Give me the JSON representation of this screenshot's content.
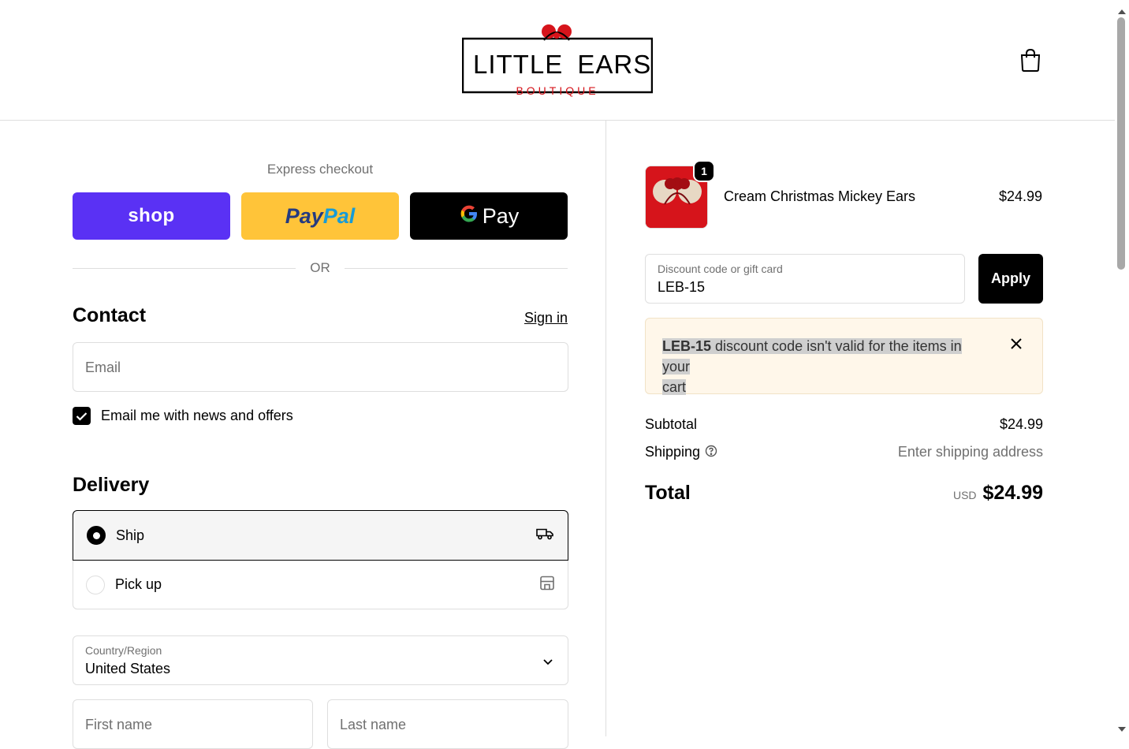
{
  "header": {
    "logo_title": "LITTLE EARS",
    "logo_subtitle": "BOUTIQUE",
    "cart_icon": "shopping-bag-icon"
  },
  "express": {
    "title": "Express checkout",
    "shop_label": "shop",
    "paypal_label_1": "Pay",
    "paypal_label_2": "Pal",
    "gpay_label": "Pay",
    "or_label": "OR"
  },
  "contact": {
    "title": "Contact",
    "sign_in": "Sign in",
    "email_placeholder": "Email",
    "newsletter_label": "Email me with news and offers",
    "newsletter_checked": true
  },
  "delivery": {
    "title": "Delivery",
    "options": [
      {
        "label": "Ship",
        "icon": "truck-icon",
        "selected": true
      },
      {
        "label": "Pick up",
        "icon": "store-icon",
        "selected": false
      }
    ],
    "country_label": "Country/Region",
    "country_value": "United States",
    "first_name_placeholder": "First name",
    "last_name_placeholder": "Last name"
  },
  "summary": {
    "product": {
      "name": "Cream Christmas Mickey Ears",
      "price": "$24.99",
      "quantity": "1"
    },
    "discount_label": "Discount code or gift card",
    "discount_value": "LEB-15",
    "apply_label": "Apply",
    "error_code": "LEB-15",
    "error_message_1": " discount code isn't valid for the items in your",
    "error_message_2": "cart",
    "subtotal_label": "Subtotal",
    "subtotal_value": "$24.99",
    "shipping_label": "Shipping",
    "shipping_value": "Enter shipping address",
    "total_label": "Total",
    "currency": "USD",
    "total_value": "$24.99"
  },
  "colors": {
    "shop_purple": "#5a31f4",
    "paypal_yellow": "#ffc439",
    "logo_red": "#d6141b",
    "alert_bg": "#fff7ea"
  }
}
